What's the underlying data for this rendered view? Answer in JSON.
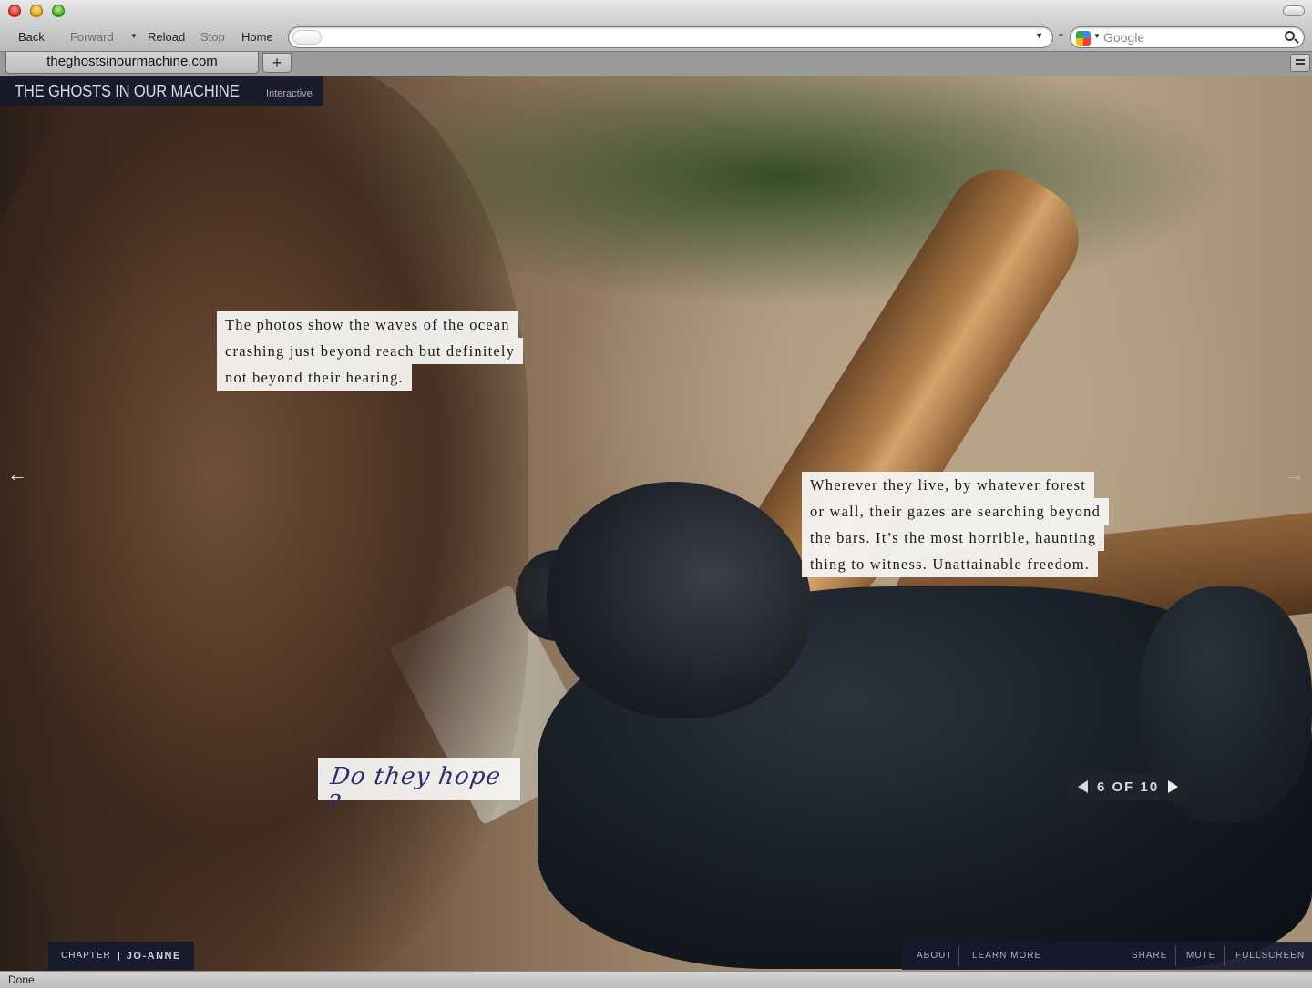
{
  "browser": {
    "toolbar": {
      "back": "Back",
      "forward": "Forward",
      "reload": "Reload",
      "stop": "Stop",
      "home": "Home"
    },
    "address_value": "",
    "search_placeholder": "Google",
    "tab_title": "theghostsinourmachine.com",
    "new_tab": "+",
    "status": "Done"
  },
  "site": {
    "title": "THE GHOSTS IN OUR MACHINE",
    "subtitle": "Interactive",
    "captions": [
      {
        "lines": [
          "The photos show the waves of the ocean",
          "crashing just beyond reach but definitely",
          "not beyond their hearing."
        ]
      },
      {
        "lines": [
          "Wherever they live, by whatever forest",
          "or wall, their gazes are searching beyond",
          "the bars. It’s the most horrible, haunting",
          "thing to witness. Unattainable freedom."
        ]
      }
    ],
    "handwritten_note": "Do they hope ?",
    "pager": {
      "text": "6 OF 10",
      "current": 6,
      "total": 10
    },
    "chapter": {
      "label": "CHAPTER",
      "name": "JO-ANNE"
    },
    "footer_nav": {
      "about": "ABOUT",
      "learn_more": "LEARN MORE",
      "share": "SHARE",
      "mute": "MUTE",
      "fullscreen": "FULLSCREEN"
    },
    "arrows": {
      "prev": "←",
      "next": "→"
    }
  },
  "colors": {
    "brand_bar": "#161a2c",
    "handwriting_ink": "#2b2e73"
  }
}
